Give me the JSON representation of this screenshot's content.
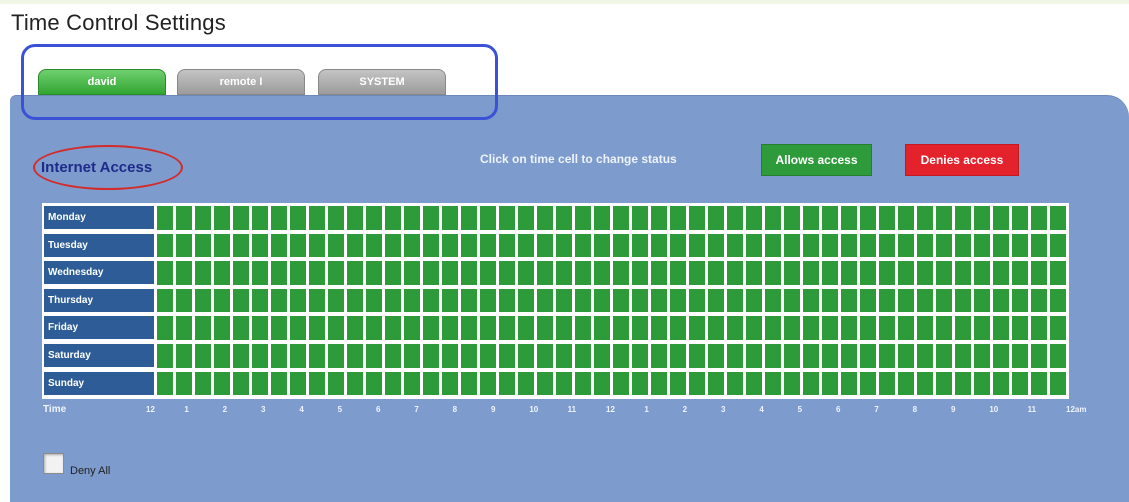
{
  "page": {
    "title": "Time Control Settings"
  },
  "tabs": [
    {
      "label": "david",
      "active": true,
      "color": "#3cb43c"
    },
    {
      "label": "remote I",
      "active": false,
      "color": "#a8a8a8"
    },
    {
      "label": "SYSTEM",
      "active": false,
      "color": "#a8a8a8"
    }
  ],
  "section": {
    "title": "Internet Access"
  },
  "instructions": "Click on time cell to change status",
  "legend": {
    "allow_label": "Allows access",
    "deny_label": "Denies access",
    "allow_color": "#2e9b3a",
    "deny_color": "#e3222c"
  },
  "schedule": {
    "days": [
      "Monday",
      "Tuesday",
      "Wednesday",
      "Thursday",
      "Friday",
      "Saturday",
      "Sunday"
    ],
    "cells_per_day": 48,
    "default_status": "allow",
    "time_header": "Time",
    "time_labels": [
      "12",
      "1",
      "2",
      "3",
      "4",
      "5",
      "6",
      "7",
      "8",
      "9",
      "10",
      "11",
      "12",
      "1",
      "2",
      "3",
      "4",
      "5",
      "6",
      "7",
      "8",
      "9",
      "10",
      "11",
      "12am"
    ]
  },
  "deny_all": {
    "label": "Deny All",
    "checked": false
  },
  "colors": {
    "panel": "#7d9bcc",
    "day_label_bg": "#2d5c96",
    "title_text": "#1e2b8a"
  }
}
